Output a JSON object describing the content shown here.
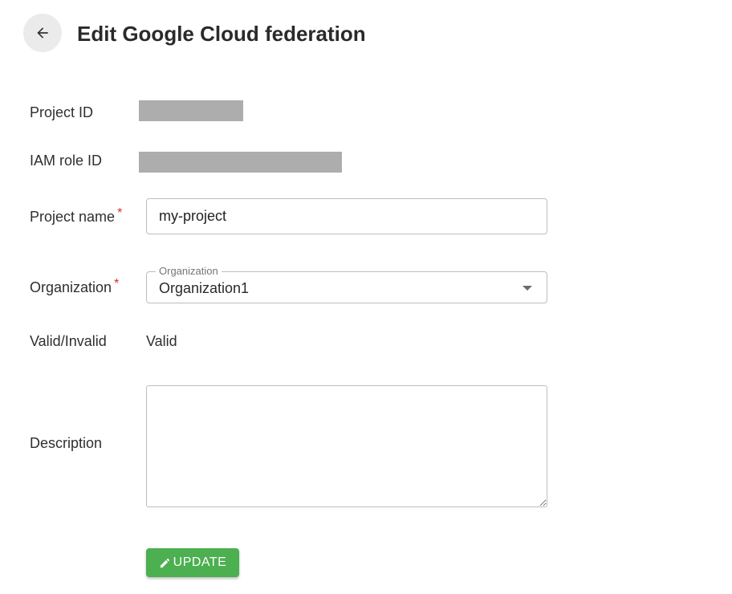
{
  "header": {
    "back_icon": "arrow-left-icon",
    "title": "Edit Google Cloud federation"
  },
  "form": {
    "project_id": {
      "label": "Project ID",
      "value_redacted": true
    },
    "iam_role_id": {
      "label": "IAM role ID",
      "value_redacted": true
    },
    "project_name": {
      "label": "Project name",
      "required_mark": "*",
      "value": "my-project"
    },
    "organization": {
      "label": "Organization",
      "required_mark": "*",
      "floating_label": "Organization",
      "selected": "Organization1",
      "dropdown_icon": "caret-down-icon"
    },
    "validity": {
      "label": "Valid/Invalid",
      "value": "Valid"
    },
    "description": {
      "label": "Description",
      "value": ""
    }
  },
  "actions": {
    "update_label": "UPDATE",
    "update_icon": "pencil-icon",
    "update_color": "#4caf50"
  },
  "colors": {
    "required": "#d32f2f",
    "redaction": "#adadad",
    "back_button_bg": "#ebebeb"
  }
}
